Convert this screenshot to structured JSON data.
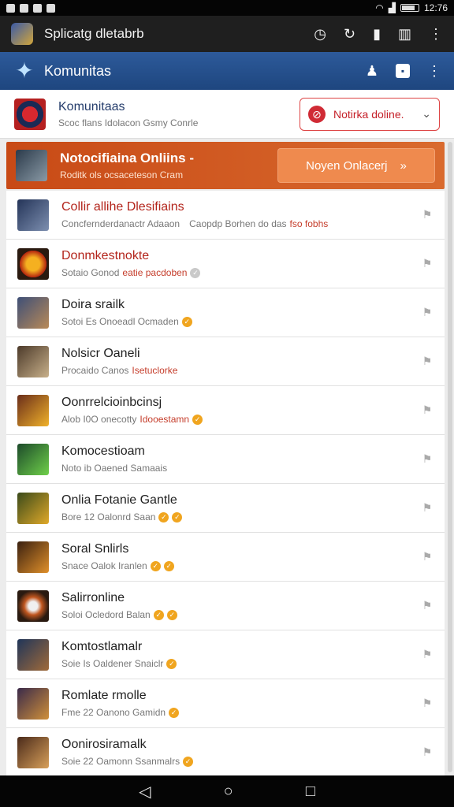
{
  "status_bar": {
    "time": "12:76"
  },
  "appbar": {
    "title": "Splicatg dletabrb"
  },
  "subbar": {
    "title": "Komunitas"
  },
  "header_card": {
    "title": "Komunitaas",
    "subtitle": "Scoc flans Idolacon Gsmy Conrle",
    "select_label": "Notirka doline."
  },
  "banner": {
    "title": "Notocifiaina Onliins -",
    "subtitle": "Roditk ols ocsaceteson Cram",
    "button_label": "Noyen Onlacerj",
    "button_icon": "»"
  },
  "rows": [
    {
      "title": "Collir allihe Dlesifiains",
      "title_red": true,
      "sub": "Concfernderdanactr Adaaon",
      "badge": "",
      "extra": "Caopdp Borhen do das",
      "extra_hl": "fso fobhs"
    },
    {
      "title": "Donmkestnokte",
      "title_red": true,
      "sub": "Sotaio Gonod",
      "extra_hl": "eatie pacdoben",
      "badge": "grey"
    },
    {
      "title": "Doira srailk",
      "title_red": false,
      "sub": "Sotoi Es Onoeadl Ocmaden",
      "badge": "orange"
    },
    {
      "title": "Nolsicr Oaneli",
      "title_red": false,
      "sub": "Procaido Canos",
      "extra_hl": "Isetuclorke",
      "badge": ""
    },
    {
      "title": "Oonrrelcioinbcinsj",
      "title_red": false,
      "sub": "Alob I0O onecotty",
      "extra_hl": "Idooestamn",
      "badge": "orange"
    },
    {
      "title": "Komocestioam",
      "title_red": false,
      "sub": "Noto ib Oaened Samaais",
      "badge": ""
    },
    {
      "title": "Onlia Fotanie Gantle",
      "title_red": false,
      "sub": "Bore 12 Oalonrd Saan",
      "badge": "orange2"
    },
    {
      "title": "Soral Snlirls",
      "title_red": false,
      "sub": "Snace Oalok Iranlen",
      "badge": "orange2"
    },
    {
      "title": "Salirronline",
      "title_red": false,
      "sub": "Soloi Ocledord Balan",
      "badge": "orange2"
    },
    {
      "title": "Komtostlamalr",
      "title_red": false,
      "sub": "Soie Is Oaldener Snaiclr",
      "badge": "orange"
    },
    {
      "title": "Romlate rmolle",
      "title_red": false,
      "sub": "Fme 22 Oanono Gamidn",
      "badge": "orange"
    },
    {
      "title": "Oonirosiramalk",
      "title_red": false,
      "sub": "Soie 22 Oamonn Ssanmalrs",
      "badge": "orange"
    }
  ],
  "colors": {
    "accent": "#c84a16",
    "subbar": "#1e467f"
  }
}
